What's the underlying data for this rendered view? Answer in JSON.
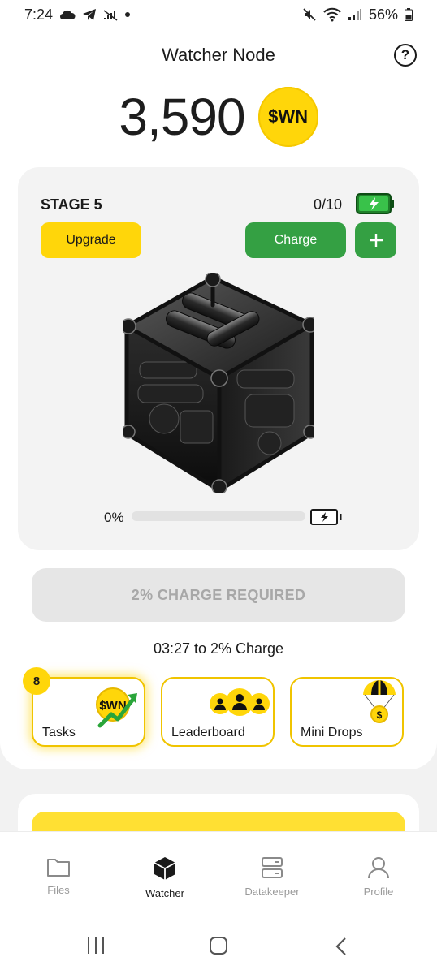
{
  "status_bar": {
    "time": "7:24",
    "battery_pct": "56%",
    "icons_left": [
      "cloud-icon",
      "telegram-icon",
      "signal-off-icon",
      "dot-icon"
    ],
    "icons_right": [
      "mute-icon",
      "wifi-icon",
      "cell-signal-icon",
      "battery-icon"
    ]
  },
  "header": {
    "title": "Watcher Node",
    "help_icon": "question-circle-icon"
  },
  "balance": {
    "value": "3,590",
    "coin_label": "$WN"
  },
  "stage_card": {
    "stage_label": "STAGE 5",
    "charges": "0/10",
    "upgrade_label": "Upgrade",
    "charge_label": "Charge",
    "plus_icon": "plus-icon",
    "progress_label": "0%",
    "progress_fraction": 0
  },
  "charge_required": "2% CHARGE REQUIRED",
  "countdown": "03:27 to 2% Charge",
  "tiles": [
    {
      "label": "Tasks",
      "icon": "wn-coin-trend-icon",
      "badge": "8"
    },
    {
      "label": "Leaderboard",
      "icon": "people-icon"
    },
    {
      "label": "Mini Drops",
      "icon": "parachute-coin-icon"
    }
  ],
  "coin_small_label": "$WN",
  "nav": [
    {
      "label": "Files",
      "icon": "folder-icon"
    },
    {
      "label": "Watcher",
      "icon": "cube-icon"
    },
    {
      "label": "Datakeeper",
      "icon": "server-icon"
    },
    {
      "label": "Profile",
      "icon": "user-icon"
    }
  ],
  "colors": {
    "accent_yellow": "#ffd60a",
    "accent_green": "#34a043",
    "disabled_text": "#a8a8a8"
  }
}
